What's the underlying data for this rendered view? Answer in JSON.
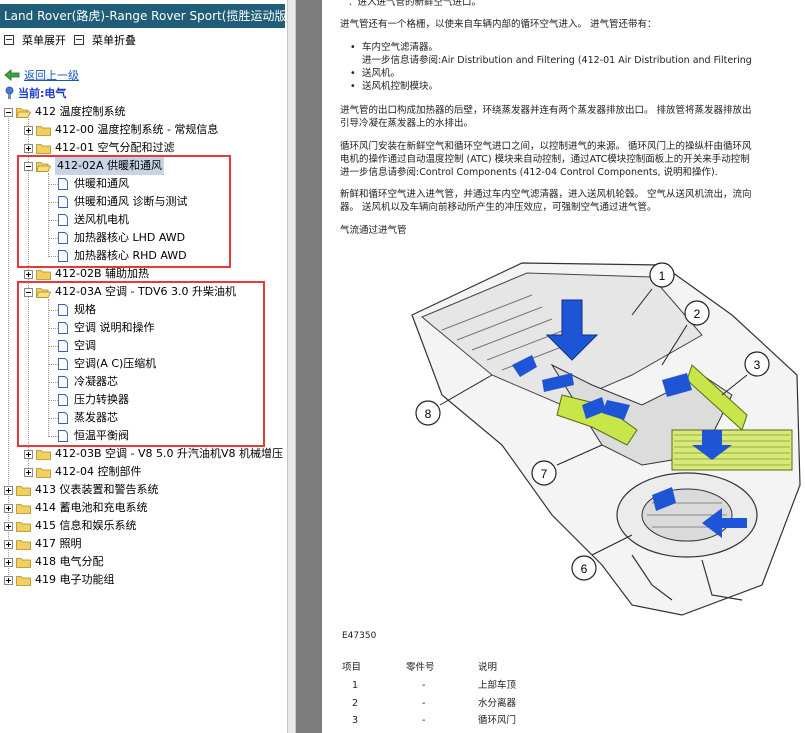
{
  "window": {
    "title": "Land Rover(路虎)-Range Rover Sport(揽胜运动版)"
  },
  "toolbar": {
    "expand_label": "菜单展开",
    "collapse_label": "菜单折叠"
  },
  "nav": {
    "back_label": "返回上一级",
    "current_label": "当前:电气"
  },
  "tree": {
    "n412": "412 温度控制系统",
    "n41200": "412-00 温度控制系统 - 常规信息",
    "n41201": "412-01 空气分配和过滤",
    "n41202a": "412-02A 供暖和通风",
    "c1": "供暖和通风",
    "c2": "供暖和通风 诊断与测试",
    "c3": "送风机电机",
    "c4": "加热器核心 LHD AWD",
    "c5": "加热器核心 RHD AWD",
    "n41202b": "412-02B 辅助加热",
    "n41203a": "412-03A 空调 - TDV6 3.0 升柴油机",
    "d1": "规格",
    "d2": "空调 说明和操作",
    "d3": "空调",
    "d4": "空调(A C)压缩机",
    "d5": "冷凝器芯",
    "d6": "压力转换器",
    "d7": "蒸发器芯",
    "d8": "恒温平衡阀",
    "n41203b": "412-03B 空调 - V8 5.0 升汽油机V8 机械增压",
    "n41204": "412-04 控制部件",
    "n413": "413 仪表装置和警告系统",
    "n414": "414 蓄电池和充电系统",
    "n415": "415 信息和娱乐系统",
    "n417": "417 照明",
    "n418": "418 电气分配",
    "n419": "419 电子功能组"
  },
  "document": {
    "line0": "：进入进气管的新鲜空气进口。",
    "line1": "进气管还有一个格栅，以使来自车辆内部的循环空气进入。 进气管还带有：",
    "b1": "车内空气滤清器。",
    "b1sub": "进一步信息请参阅:Air Distribution and Filtering (412-01 Air Distribution and Filtering",
    "b2": "送风机。",
    "b3": "送风机控制模块。",
    "p2a": "进气管的出口构成加热器的后壁，环绕蒸发器并连有两个蒸发器排放出口。 排放管将蒸发器排放出",
    "p2b": "引导冷凝在蒸发器上的水排出。",
    "p3a": "循环风门安装在新鲜空气和循环空气进口之间，以控制进气的来源。 循环风门上的操纵杆由循环风",
    "p3b": "电机的操作通过自动温度控制 (ATC) 模块来自动控制，通过ATC模块控制面板上的开关来手动控制",
    "p3c": "进一步信息请参阅:Control Components (412-04 Control Components, 说明和操作).",
    "p4a": "新鲜和循环空气进入进气管，并通过车内空气滤清器，进入送风机轮毂。 空气从送风机流出，流向",
    "p4b": "器。 送风机以及车辆向前移动所产生的冲压效应，可强制空气通过进气管。",
    "caption": "气流通过进气管",
    "figure_id": "E47350",
    "callouts": [
      "1",
      "2",
      "3",
      "6",
      "7",
      "8"
    ],
    "table_headers": [
      "项目",
      "零件号",
      "说明"
    ],
    "table_rows": [
      {
        "item": "1",
        "part": "-",
        "desc": "上部车顶"
      },
      {
        "item": "2",
        "part": "-",
        "desc": "水分离器"
      },
      {
        "item": "3",
        "part": "-",
        "desc": "循环风门"
      }
    ]
  },
  "colors": {
    "titlebar": "#1f5d78",
    "highlight_box": "#e53a3a",
    "selection": "#c8d3e6",
    "diagram_arrow": "#1e55d6",
    "diagram_accent": "#c8e64a"
  }
}
